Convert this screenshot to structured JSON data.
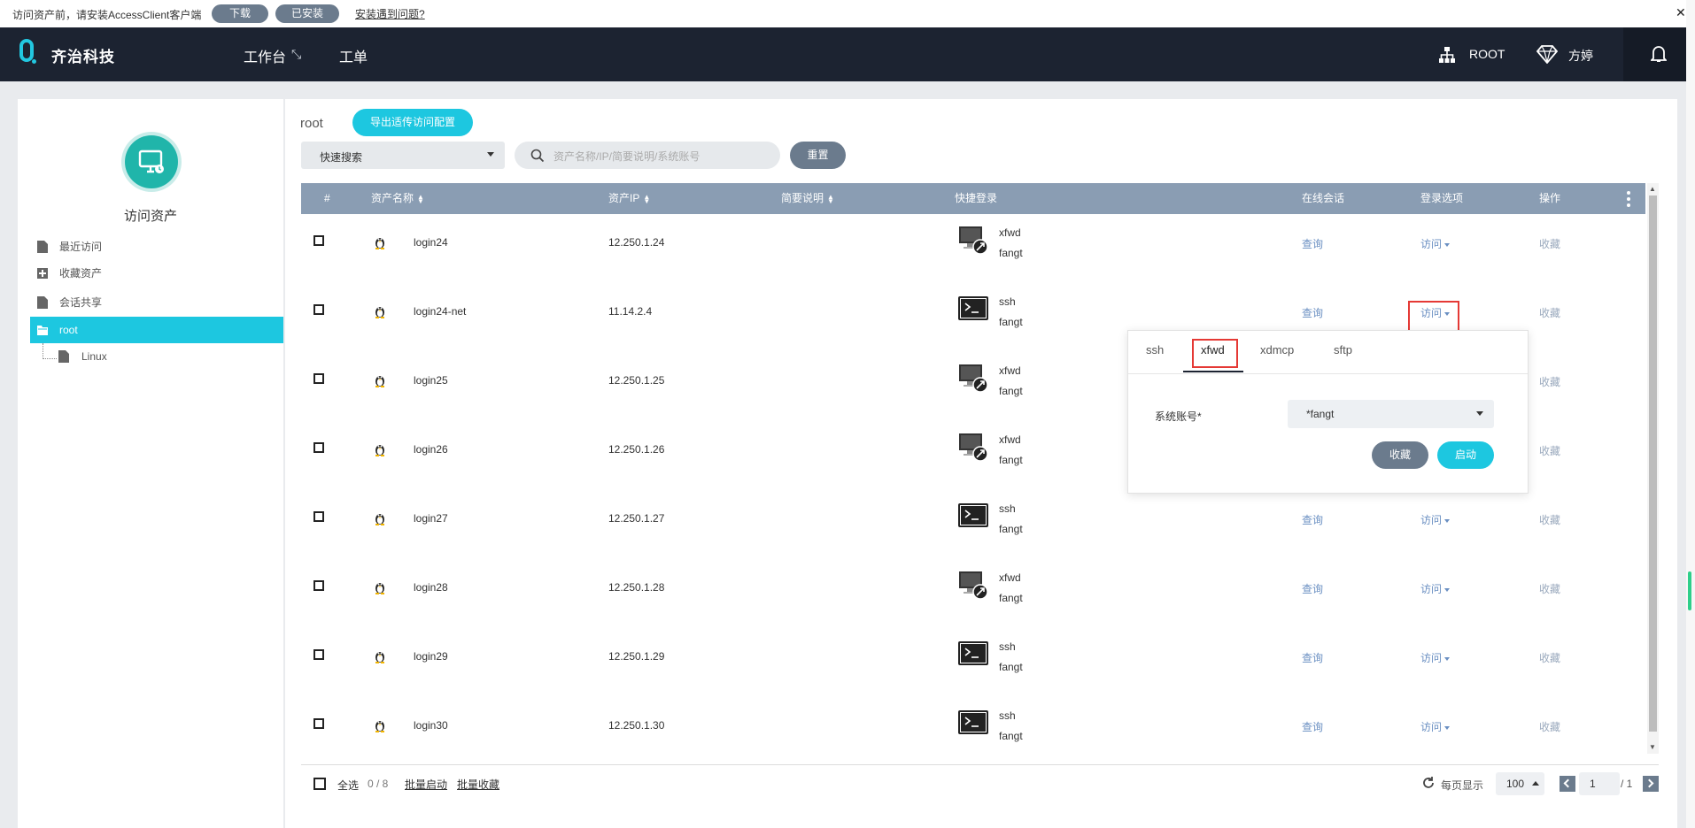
{
  "notice": {
    "text": "访问资产前，请安装AccessClient客户端",
    "download": "下载",
    "installed": "已安装",
    "issue_link": "安装遇到问题?"
  },
  "header": {
    "brand": "齐治科技",
    "nav": [
      {
        "label": "工作台"
      },
      {
        "label": "工单"
      }
    ],
    "org": "ROOT",
    "user": "方婷"
  },
  "sidebar": {
    "title": "访问资产",
    "items": [
      {
        "label": "最近访问",
        "icon": "document-icon"
      },
      {
        "label": "收藏资产",
        "icon": "plus-box-icon"
      },
      {
        "label": "会话共享",
        "icon": "document-icon"
      },
      {
        "label": "root",
        "icon": "folder-icon",
        "selected": true
      },
      {
        "label": "Linux",
        "icon": "document-icon"
      }
    ]
  },
  "toolbar": {
    "crumb": "root",
    "export": "导出适传访问配置",
    "quick_search": "快速搜索",
    "search_placeholder": "资产名称/IP/简要说明/系统账号",
    "reset": "重置"
  },
  "table": {
    "headers": {
      "index": "#",
      "name": "资产名称",
      "ip": "资产IP",
      "desc": "简要说明",
      "quick": "快捷登录",
      "session": "在线会话",
      "login": "登录选项",
      "action": "操作"
    },
    "rows": [
      {
        "name": "login24",
        "ip": "12.250.1.24",
        "protocol": "xfwd",
        "account": "fangt",
        "session": "查询",
        "login": "访问",
        "action": "收藏"
      },
      {
        "name": "login24-net",
        "ip": "11.14.2.4",
        "protocol": "ssh",
        "account": "fangt",
        "session": "查询",
        "login": "访问",
        "action": "收藏"
      },
      {
        "name": "login25",
        "ip": "12.250.1.25",
        "protocol": "xfwd",
        "account": "fangt",
        "session": "",
        "login": "",
        "action": "收藏"
      },
      {
        "name": "login26",
        "ip": "12.250.1.26",
        "protocol": "xfwd",
        "account": "fangt",
        "session": "",
        "login": "",
        "action": "收藏"
      },
      {
        "name": "login27",
        "ip": "12.250.1.27",
        "protocol": "ssh",
        "account": "fangt",
        "session": "查询",
        "login": "访问",
        "action": "收藏"
      },
      {
        "name": "login28",
        "ip": "12.250.1.28",
        "protocol": "xfwd",
        "account": "fangt",
        "session": "查询",
        "login": "访问",
        "action": "收藏"
      },
      {
        "name": "login29",
        "ip": "12.250.1.29",
        "protocol": "ssh",
        "account": "fangt",
        "session": "查询",
        "login": "访问",
        "action": "收藏"
      },
      {
        "name": "login30",
        "ip": "12.250.1.30",
        "protocol": "ssh",
        "account": "fangt",
        "session": "查询",
        "login": "访问",
        "action": "收藏"
      }
    ]
  },
  "footer": {
    "select_all": "全选",
    "count": "0 / 8",
    "batch_start": "批量启动",
    "batch_fav": "批量收藏",
    "per_page_label": "每页显示",
    "per_page": "100",
    "page": "1",
    "total_pages": "/ 1"
  },
  "popover": {
    "tabs": [
      "ssh",
      "xfwd",
      "xdmcp",
      "sftp"
    ],
    "active_tab": "xfwd",
    "account_label": "系统账号*",
    "account_value": "*fangt",
    "fav": "收藏",
    "start": "启动"
  },
  "colors": {
    "accent": "#1dc7e0",
    "header_bg": "#1c2331",
    "table_header": "#8a9db3",
    "highlight": "#e53935"
  }
}
